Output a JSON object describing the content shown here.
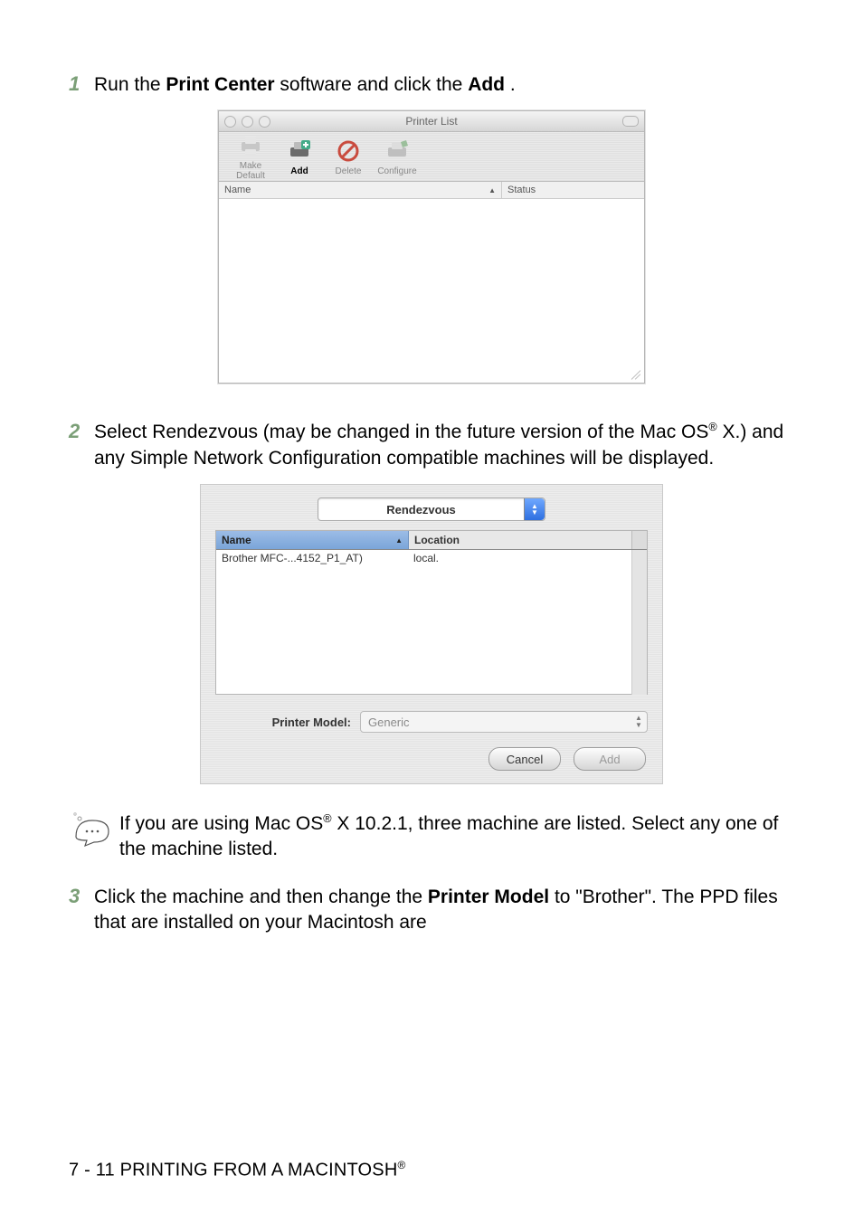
{
  "step1": {
    "num": "1",
    "pre": "Run the ",
    "bold1": "Print Center",
    "mid": " software and click the ",
    "bold2": "Add",
    "post": "."
  },
  "printer_list": {
    "title": "Printer List",
    "toolbar": {
      "make_default": "Make Default",
      "add": "Add",
      "delete": "Delete",
      "configure": "Configure"
    },
    "columns": {
      "name": "Name",
      "status": "Status"
    }
  },
  "step2": {
    "num": "2",
    "line1": "Select Rendezvous (may be changed in the future version of the ",
    "os_pre": "Mac OS",
    "os_post": " X.) and any Simple Network Configuration compatible ",
    "line3": "machines will be displayed."
  },
  "rendezvous": {
    "select": "Rendezvous",
    "headers": {
      "name": "Name",
      "location": "Location"
    },
    "rows": [
      {
        "name": "Brother MFC-...4152_P1_AT)",
        "location": "local."
      }
    ],
    "model_label": "Printer Model:",
    "model_value": "Generic",
    "cancel": "Cancel",
    "add": "Add"
  },
  "note": {
    "pre": "If you are using Mac OS",
    "post": " X 10.2.1, three machine are listed. Select any one of the machine listed."
  },
  "step3": {
    "num": "3",
    "line1": "Click the machine and then change the ",
    "bold": "Printer Model",
    "line2": " to \"Brother\". The PPD files that are installed on your Macintosh are "
  },
  "footer": {
    "pre": "7 - 11 PRINTING FROM A MACINTOSH"
  }
}
